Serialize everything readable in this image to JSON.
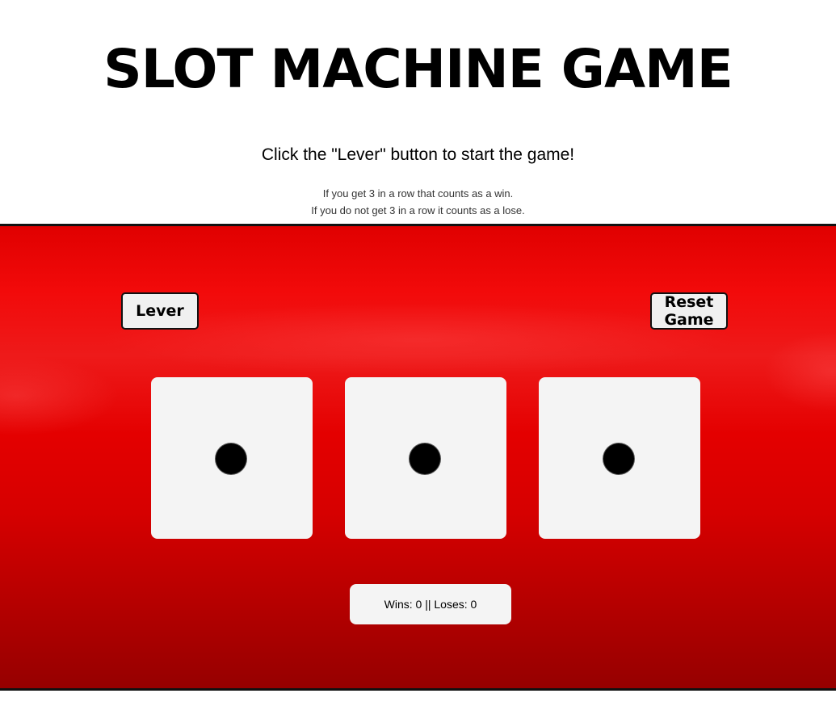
{
  "header": {
    "title": "SLOT MACHINE GAME",
    "instruction": "Click the \"Lever\" button to start the game!",
    "rules": [
      "If you get 3 in a row that counts as a win.",
      "If you do not get 3 in a row it counts as a lose."
    ]
  },
  "controls": {
    "lever_label": "Lever",
    "reset_label": "Reset Game"
  },
  "reels": [
    {
      "face": "one-pip"
    },
    {
      "face": "one-pip"
    },
    {
      "face": "one-pip"
    }
  ],
  "scoreboard": {
    "text": "Wins: 0 || Loses: 0"
  },
  "colors": {
    "stage_red": "#e00000",
    "reel_bg": "#f4f4f4",
    "pip": "#000000"
  }
}
